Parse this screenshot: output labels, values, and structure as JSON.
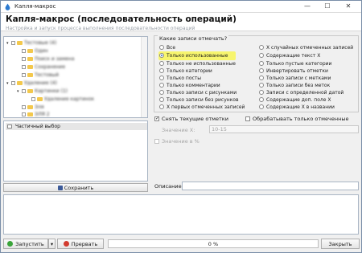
{
  "window": {
    "title": "Капля-макрос",
    "header_title": "Капля-макрос (последовательность операций)",
    "header_subtitle": "Настройка и запуск процесса выполнения последовательности операций"
  },
  "tree": {
    "items": [
      "Тестовые (4)",
      "Один",
      "Поиск и замена",
      "Сохранение",
      "Тестовый",
      "Удаление (4)",
      "Картинки (1)",
      "Удаление картинок",
      "Эля",
      "ЭЛЯ 2"
    ]
  },
  "selection_list": {
    "item": "Частичный выбор"
  },
  "save_button": "Сохранить",
  "records_group": {
    "title": "Какие записи отмечать?",
    "left_options": [
      "Все",
      "Только использованные",
      "Только не использованные",
      "Только категории",
      "Только посты",
      "Только комментарии",
      "Только записи с рисунками",
      "Только записи без рисунков",
      "X первых отмеченных записей"
    ],
    "right_options": [
      "X случайных отмеченных записей",
      "Содержащие текст X",
      "Только пустые категории",
      "Инвертировать отметки",
      "Только записи с метками",
      "Только записи без меток",
      "Записи с определенной датой",
      "Содержащие доп. поле X",
      "Содержащие X в названии"
    ],
    "selected": "Только использованные"
  },
  "options": {
    "reset_marks": "Снять текущие отметки",
    "process_marked": "Обрабатывать только отмеченные",
    "value_x_label": "Значение X:",
    "value_x": "10-15",
    "value_percent": "Значение в %"
  },
  "description_label": "Описание:",
  "footer": {
    "run": "Запустить",
    "stop": "Прервать",
    "progress": "0 %",
    "close": "Закрыть"
  }
}
